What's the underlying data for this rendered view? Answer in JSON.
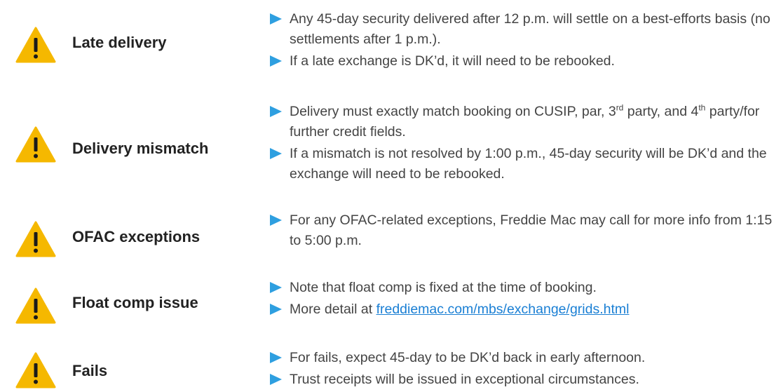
{
  "sections": [
    {
      "title": "Late delivery",
      "icon": "warning-icon",
      "bullets": [
        {
          "text": "Any 45-day security delivered after 12 p.m. will settle on a best-efforts basis (no settlements after 1 p.m.)."
        },
        {
          "text": "If a late exchange is DK’d, it will need to be rebooked."
        }
      ]
    },
    {
      "title": "Delivery mismatch",
      "icon": "warning-icon",
      "bullets": [
        {
          "pre": "Delivery must exactly match booking on CUSIP, par, 3",
          "sup1": "rd",
          "mid": " party, and 4",
          "sup2": "th",
          "post": " party/for further credit fields."
        },
        {
          "text": "If a mismatch is not resolved by 1:00 p.m., 45-day security will be DK’d and the exchange will need to be rebooked."
        }
      ]
    },
    {
      "title": "OFAC exceptions",
      "icon": "warning-icon",
      "bullets": [
        {
          "text": "For any OFAC-related exceptions, Freddie Mac may call for more info from 1:15 to 5:00 p.m."
        }
      ]
    },
    {
      "title": "Float comp issue",
      "icon": "warning-icon",
      "bullets": [
        {
          "text": "Note that float comp is fixed at the time of booking."
        },
        {
          "pre": "More detail at ",
          "link": "freddiemac.com/mbs/exchange/grids.html"
        }
      ]
    },
    {
      "title": "Fails",
      "icon": "warning-icon",
      "bullets": [
        {
          "text": "For fails, expect 45-day to be DK’d back in early afternoon."
        },
        {
          "text": "Trust receipts will be issued in exceptional circumstances."
        }
      ]
    }
  ],
  "colors": {
    "warning_fill": "#f5b800",
    "warning_mark": "#1a1a1a",
    "bullet_arrow": "#2e9fe0",
    "link": "#1a7fd4"
  }
}
